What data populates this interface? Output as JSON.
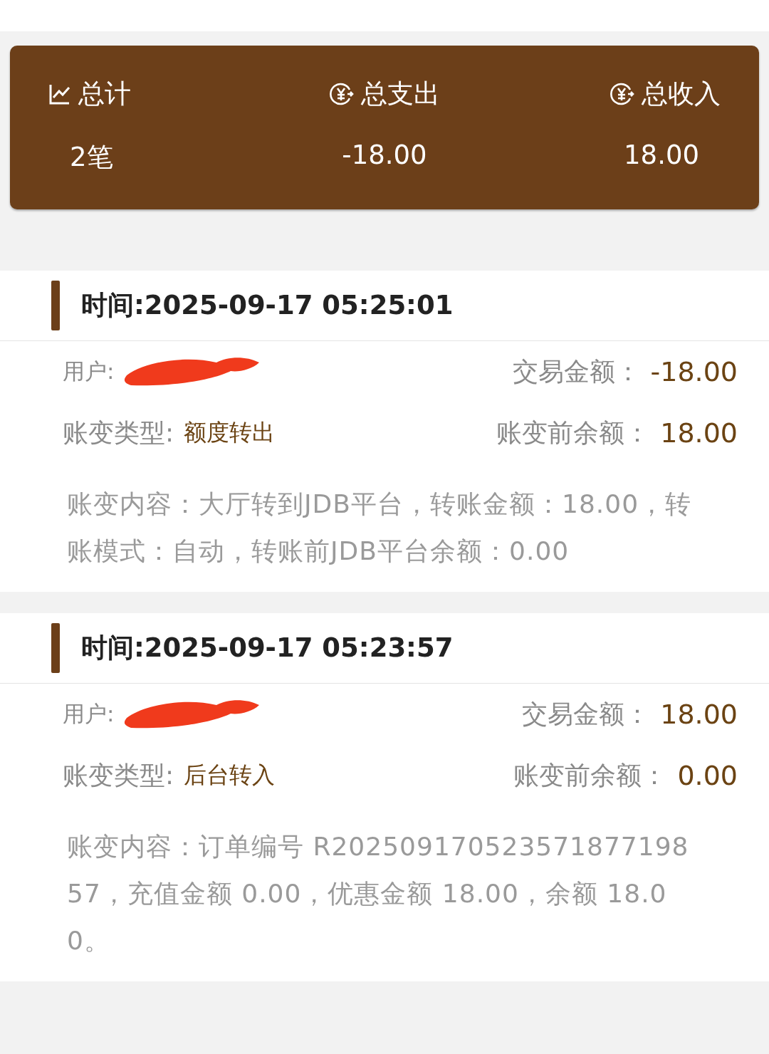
{
  "summary": [
    {
      "label": "总计",
      "value": "2笔"
    },
    {
      "label": "总支出",
      "value": "-18.00"
    },
    {
      "label": "总收入",
      "value": "18.00"
    }
  ],
  "records": [
    {
      "time": "时间:2025-09-17 05:25:01",
      "user_label": "用户:",
      "amount_label": "交易金额：",
      "amount": "-18.00",
      "type_label": "账变类型:",
      "type_value": "额度转出",
      "balance_label": "账变前余额：",
      "balance": "18.00",
      "content": "账变内容：大厅转到JDB平台，转账金额：18.00，转账模式：自动，转账前JDB平台余额：0.00"
    },
    {
      "time": "时间:2025-09-17 05:23:57",
      "user_label": "用户:",
      "amount_label": "交易金额：",
      "amount": "18.00",
      "type_label": "账变类型:",
      "type_value": "后台转入",
      "balance_label": "账变前余额：",
      "balance": "0.00",
      "content": "账变内容：订单编号 R20250917052357187719857，充值金额 0.00，优惠金额 18.00，余额 18.00。"
    }
  ]
}
